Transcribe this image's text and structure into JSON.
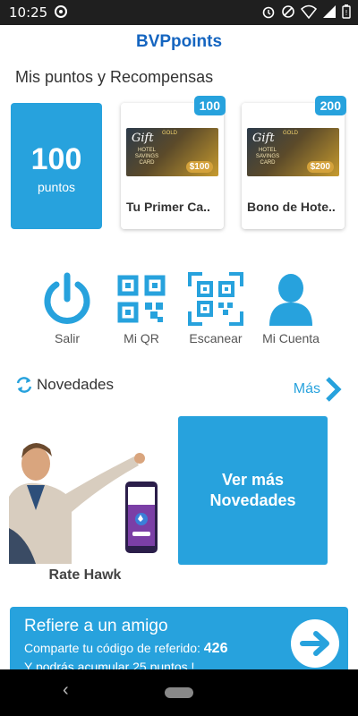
{
  "status_bar": {
    "time": "10:25",
    "icons": [
      "at-icon",
      "alarm-icon",
      "dnd-icon",
      "wifi-icon",
      "signal-icon",
      "battery-icon"
    ]
  },
  "app": {
    "title": "BVPpoints"
  },
  "rewards_section": {
    "title": "Mis puntos y Recompensas",
    "points_value": "100",
    "points_label": "puntos",
    "cards": [
      {
        "badge": "100",
        "name": "Tu Primer Ca..",
        "img_amount": "$100"
      },
      {
        "badge": "200",
        "name": "Bono de Hote..",
        "img_amount": "$200"
      }
    ],
    "card_art": {
      "gift": "Gift",
      "gold": "GOLD",
      "hotel": "HOTEL SAVINGS CARD"
    }
  },
  "actions": [
    {
      "label": "Salir",
      "icon": "power-icon"
    },
    {
      "label": "Mi QR",
      "icon": "qr-code-icon"
    },
    {
      "label": "Escanear",
      "icon": "scan-qr-icon"
    },
    {
      "label": "Mi Cuenta",
      "icon": "user-icon"
    }
  ],
  "news": {
    "title": "Novedades",
    "more_label": "Más",
    "items": [
      {
        "label": "Rate Hawk"
      }
    ],
    "more_news_tile": "Ver más Novedades"
  },
  "referral": {
    "title": "Refiere a un amigo",
    "code_text": "Comparte tu código de referido: ",
    "code": "426",
    "points_text": "Y podrás acumular 25 puntos !"
  },
  "colors": {
    "accent": "#27a2dd",
    "title_blue": "#1565c0"
  }
}
